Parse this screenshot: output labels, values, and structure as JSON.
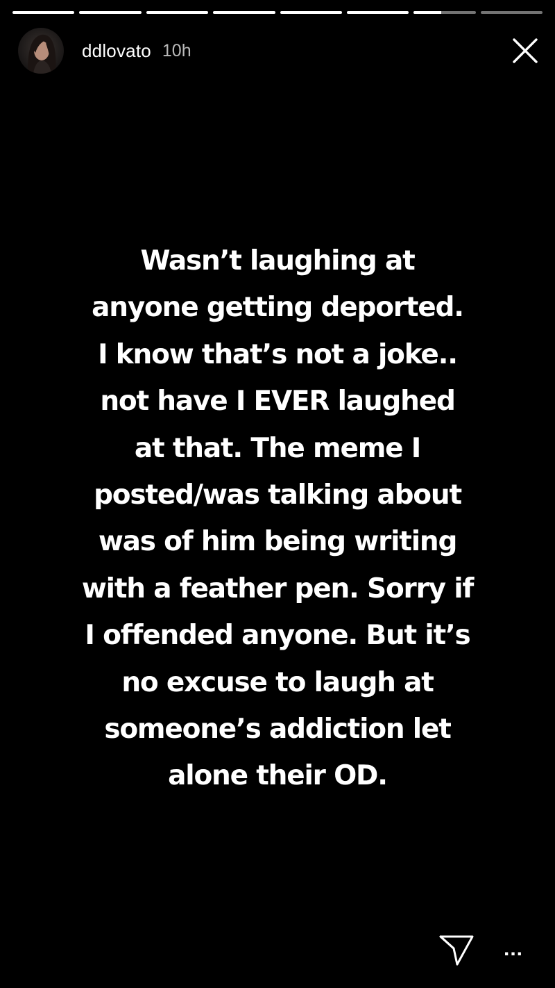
{
  "story": {
    "segment_count": 8,
    "segment_progress": [
      1,
      1,
      1,
      1,
      1,
      1,
      0.45,
      0
    ],
    "colors": {
      "background": "#000000",
      "text": "#ffffff"
    }
  },
  "header": {
    "username": "ddlovato",
    "time_ago": "10h",
    "avatar_icon": "profile-photo",
    "close_icon": "close-x-icon"
  },
  "caption": {
    "lines": [
      "Wasn’t laughing at",
      "anyone getting deported.",
      "I know that’s not a joke..",
      "not have I EVER laughed",
      "at that. The meme I",
      "posted/was talking about",
      "was of him being writing",
      "with a feather pen. Sorry if",
      "I offended anyone. But it’s",
      "no excuse to laugh at",
      "someone’s addiction let",
      "alone their OD."
    ]
  },
  "footer": {
    "send_icon": "paper-plane-icon",
    "more_label": "..."
  }
}
